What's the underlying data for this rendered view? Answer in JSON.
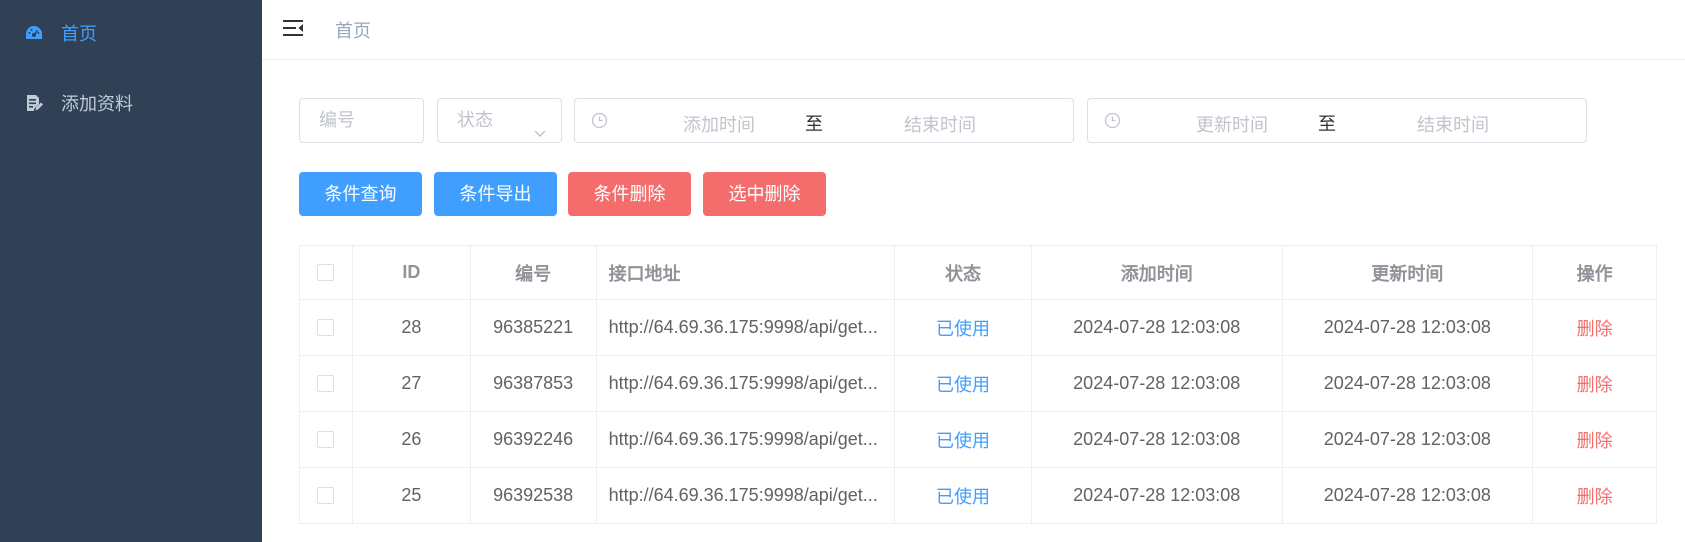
{
  "colors": {
    "sidebar_bg": "#304156",
    "primary": "#409eff",
    "danger": "#f56c6c"
  },
  "sidebar": {
    "items": [
      {
        "label": "首页",
        "icon": "dashboard-icon",
        "active": true
      },
      {
        "label": "添加资料",
        "icon": "document-edit-icon",
        "active": false
      }
    ]
  },
  "header": {
    "breadcrumb": "首页",
    "menu_icon": "hamburger-icon"
  },
  "filters": {
    "code_placeholder": "编号",
    "status_placeholder": "状态",
    "add_time": {
      "start": "添加时间",
      "sep": "至",
      "end": "结束时间"
    },
    "update_time": {
      "start": "更新时间",
      "sep": "至",
      "end": "结束时间"
    }
  },
  "buttons": {
    "query": "条件查询",
    "export": "条件导出",
    "delete_by_cond": "条件删除",
    "delete_selected": "选中删除"
  },
  "table": {
    "headers": [
      "ID",
      "编号",
      "接口地址",
      "状态",
      "添加时间",
      "更新时间",
      "操作"
    ],
    "rows": [
      {
        "id": "28",
        "code": "96385221",
        "url": "http://64.69.36.175:9998/api/get...",
        "status": "已使用",
        "added": "2024-07-28 12:03:08",
        "updated": "2024-07-28 12:03:08",
        "action": "删除"
      },
      {
        "id": "27",
        "code": "96387853",
        "url": "http://64.69.36.175:9998/api/get...",
        "status": "已使用",
        "added": "2024-07-28 12:03:08",
        "updated": "2024-07-28 12:03:08",
        "action": "删除"
      },
      {
        "id": "26",
        "code": "96392246",
        "url": "http://64.69.36.175:9998/api/get...",
        "status": "已使用",
        "added": "2024-07-28 12:03:08",
        "updated": "2024-07-28 12:03:08",
        "action": "删除"
      },
      {
        "id": "25",
        "code": "96392538",
        "url": "http://64.69.36.175:9998/api/get...",
        "status": "已使用",
        "added": "2024-07-28 12:03:08",
        "updated": "2024-07-28 12:03:08",
        "action": "删除"
      }
    ]
  }
}
